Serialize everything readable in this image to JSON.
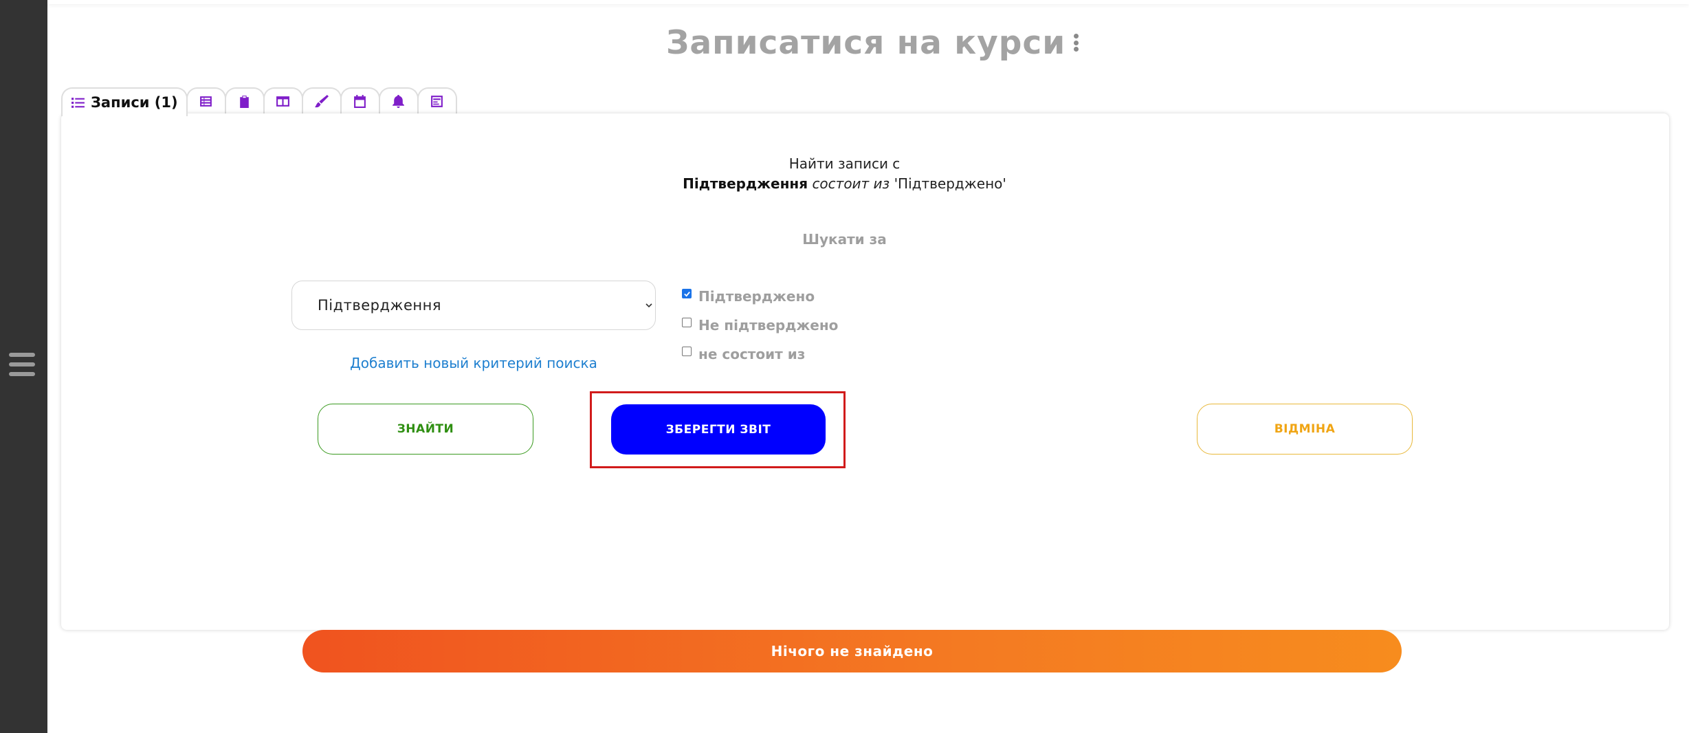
{
  "page": {
    "title": "Записатися на курси"
  },
  "tabs": {
    "active_label": "Записи (1)",
    "icons": [
      "list-icon",
      "table-list-icon",
      "clipboard-icon",
      "columns-icon",
      "brush-icon",
      "calendar-icon",
      "bell-icon",
      "report-icon"
    ]
  },
  "filter": {
    "summary_line1": "Найти записи с",
    "summary_field": "Підтвердження",
    "summary_operator": "состоит из",
    "summary_value": "'Підтверджено'",
    "search_by_label": "Шукати за",
    "select_value": "Підтвердження",
    "add_criteria_link": "Добавить новый критерий поиска",
    "options": [
      {
        "label": "Підтверджено",
        "checked": true
      },
      {
        "label": "Не підтверджено",
        "checked": false
      },
      {
        "label": "не состоит из",
        "checked": false
      }
    ]
  },
  "buttons": {
    "find": "ЗНАЙТИ",
    "save_report": "ЗБЕРЕГТИ ЗВІТ",
    "cancel": "ВІДМІНА"
  },
  "result": {
    "message": "Нічого не знайдено"
  },
  "colors": {
    "accent_purple": "#7f1ec9",
    "save_button": "#0000ff",
    "find_green": "#2f8f12",
    "cancel_amber": "#f0a514",
    "banner_orange": "#f0531f",
    "highlight_red": "#d11b1b"
  }
}
